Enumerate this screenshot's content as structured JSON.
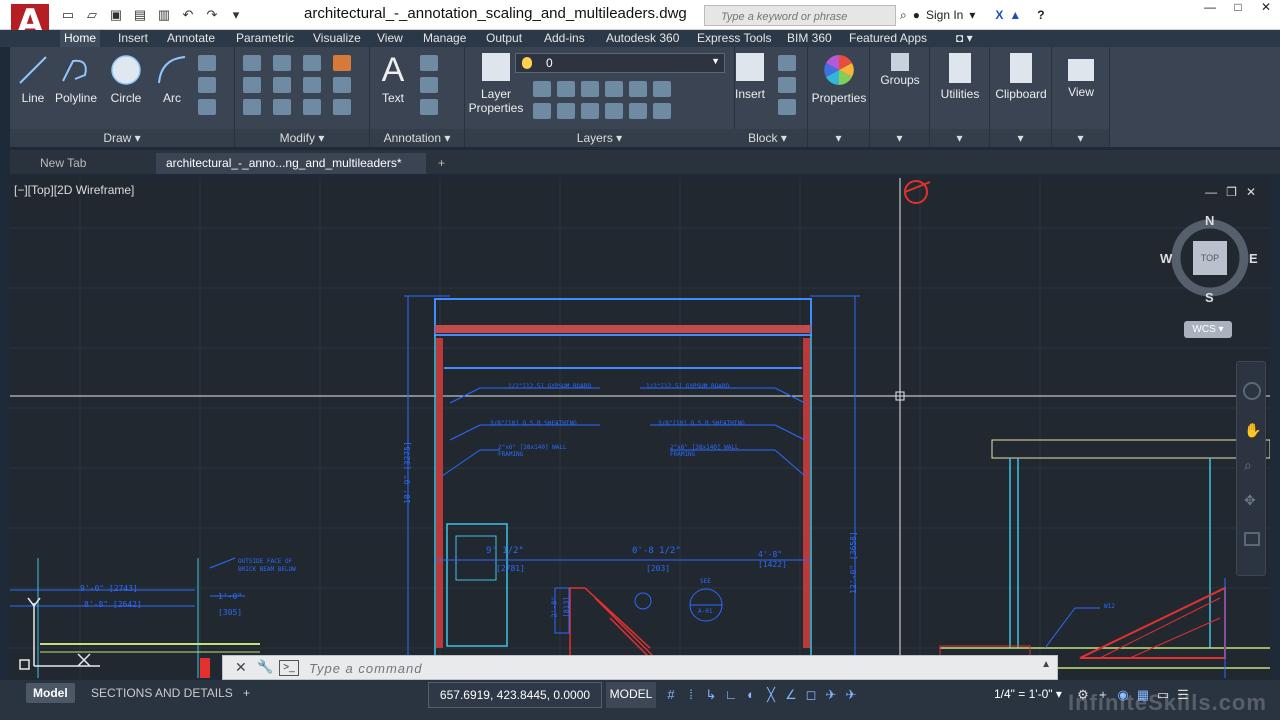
{
  "titlebar": {
    "app_logo": "A",
    "doc_title": "architectural_-_annotation_scaling_and_multileaders.dwg",
    "search_placeholder": "Type a keyword or phrase",
    "sign_in": "Sign In"
  },
  "ribbon_tabs": [
    "Home",
    "Insert",
    "Annotate",
    "Parametric",
    "Visualize",
    "View",
    "Manage",
    "Output",
    "Add-ins",
    "Autodesk 360",
    "Express Tools",
    "BIM 360",
    "Featured Apps"
  ],
  "ribbon": {
    "draw": {
      "title": "Draw",
      "tools": [
        "Line",
        "Polyline",
        "Circle",
        "Arc"
      ]
    },
    "modify": {
      "title": "Modify"
    },
    "annotation": {
      "title": "Annotation",
      "text": "Text"
    },
    "layers": {
      "title": "Layers",
      "layer_properties_line1": "Layer",
      "layer_properties_line2": "Properties",
      "current_layer": "0"
    },
    "block": {
      "title": "Block",
      "insert": "Insert"
    },
    "properties": {
      "label": "Properties"
    },
    "groups": {
      "label": "Groups"
    },
    "utilities": {
      "label": "Utilities"
    },
    "clipboard": {
      "label": "Clipboard"
    },
    "view": {
      "label": "View"
    }
  },
  "doc_tabs": [
    "New Tab",
    "architectural_-_anno...ng_and_multileaders*"
  ],
  "viewport": {
    "label": "[−][Top][2D Wireframe]",
    "viewcube": {
      "top_face": "TOP",
      "north": "N",
      "south": "S",
      "east": "E",
      "west": "W"
    },
    "wcs": "WCS"
  },
  "drawing_text": {
    "gypsum_left": "1/2\"[12.5] GYPSUM BOARD",
    "gypsum_right": "1/2\"[12.5] GYPSUM BOARD",
    "osb_left": "3/8\"[10] O.S.B SHEATHING",
    "osb_right": "3/8\"[10] O.S.B SHEATHING",
    "stud_left_1": "2\"x6\" [38x140] WALL",
    "stud_left_2": "FRAMING",
    "stud_right_1": "2\"x6\" [38x140] WALL",
    "stud_right_2": "FRAMING",
    "dim_height_left": "10'-9\" [3275]",
    "dim_height_right": "12'-0\" [3658]",
    "dim_a": "9' 1/2\"",
    "dim_a_mm": "[2781]",
    "dim_b": "0'-8 1/2\"",
    "dim_b_mm": "[203]",
    "dim_c": "4'-8\"",
    "dim_c_mm": "[1422]",
    "dim_d": "9'-0\" [2743]",
    "dim_e": "8'-8\" [2642]",
    "dim_f": "1'-0\"",
    "dim_f_mm": "[305]",
    "beam_note_1": "OUTSIDE FACE OF",
    "beam_note_2": "BRICK BEAM BELOW",
    "see_label": "SEE",
    "detail_tag": "A-01",
    "w12": "W12",
    "dim_g": "2'-8\"",
    "dim_g_mm": "[813]"
  },
  "command": {
    "placeholder": "Type a command"
  },
  "statusbar": {
    "tabs": [
      "Model",
      "SECTIONS AND DETAILS"
    ],
    "coords": "657.6919, 423.8445, 0.0000",
    "model": "MODEL",
    "scale": "1/4\" = 1'-0\""
  },
  "watermark": "InfiniteSkills.com",
  "colors": {
    "canvas_bg": "#212830",
    "drawing_blue": "#2b6bff",
    "drawing_cyan": "#3fc3e6",
    "drawing_red": "#e53030",
    "ribbon_bg": "#3b4453"
  }
}
